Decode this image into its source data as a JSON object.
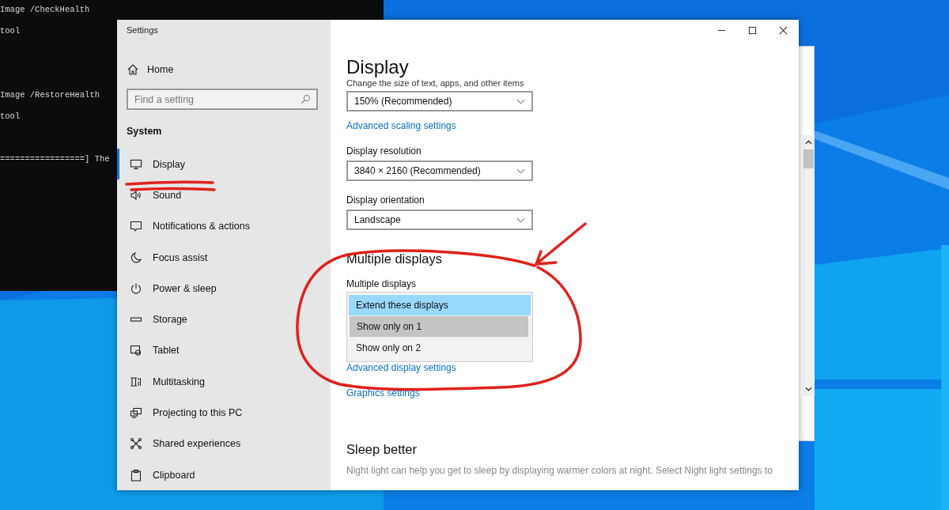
{
  "console": {
    "commands": [
      {
        "command": "Image /CheckHealth",
        "output": "tool"
      },
      {
        "command": "Image /RestoreHealth",
        "output": "tool"
      }
    ],
    "progress": "=================] The"
  },
  "window": {
    "title": "Settings"
  },
  "sidebar": {
    "home": "Home",
    "search": {
      "placeholder": "Find a setting"
    },
    "section": "System",
    "items": [
      {
        "label": "Display",
        "kind": "display",
        "selected": true
      },
      {
        "label": "Sound",
        "kind": "sound",
        "selected": false
      },
      {
        "label": "Notifications & actions",
        "kind": "notifications",
        "selected": false
      },
      {
        "label": "Focus assist",
        "kind": "focus",
        "selected": false
      },
      {
        "label": "Power & sleep",
        "kind": "power",
        "selected": false
      },
      {
        "label": "Storage",
        "kind": "storage",
        "selected": false
      },
      {
        "label": "Tablet",
        "kind": "tablet",
        "selected": false
      },
      {
        "label": "Multitasking",
        "kind": "multitasking",
        "selected": false
      },
      {
        "label": "Projecting to this PC",
        "kind": "projecting",
        "selected": false
      },
      {
        "label": "Shared experiences",
        "kind": "shared",
        "selected": false
      },
      {
        "label": "Clipboard",
        "kind": "clipboard",
        "selected": false
      }
    ]
  },
  "content": {
    "title": "Display",
    "scale_caption": "Change the size of text, apps, and other items",
    "scale": {
      "value": "150% (Recommended)"
    },
    "scaling_link": "Advanced scaling settings",
    "resolution_label": "Display resolution",
    "resolution": {
      "value": "3840 × 2160 (Recommended)"
    },
    "orientation_label": "Display orientation",
    "orientation": {
      "value": "Landscape"
    },
    "multiple_heading": "Multiple displays",
    "multiple_label": "Multiple displays",
    "multiple_options": [
      {
        "label": "Extend these displays",
        "selected": true,
        "hovered": false
      },
      {
        "label": "Show only on 1",
        "selected": false,
        "hovered": true
      },
      {
        "label": "Show only on 2",
        "selected": false,
        "hovered": false
      }
    ],
    "display_link": "Advanced display settings",
    "graphics_link": "Graphics settings",
    "sleep_heading": "Sleep better",
    "sleep_text": "Night light can help you get to sleep by displaying warmer colors at night. Select Night light settings to"
  }
}
